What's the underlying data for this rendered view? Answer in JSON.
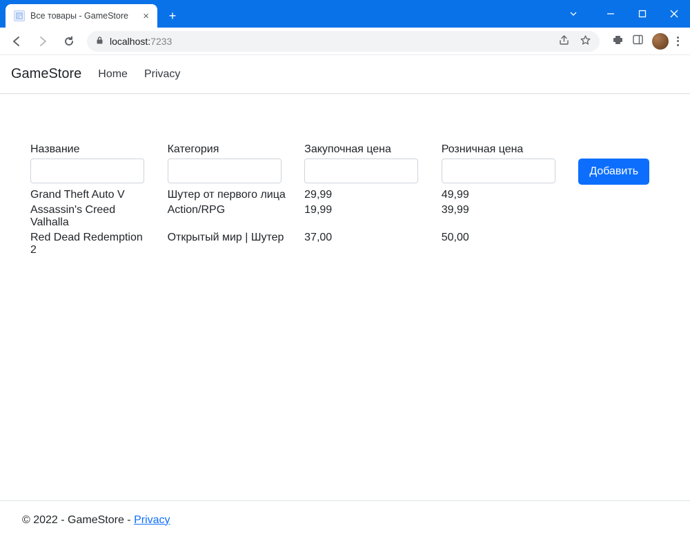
{
  "browser": {
    "tab_title": "Все товары - GameStore",
    "url_host": "localhost:",
    "url_port": "7233"
  },
  "navbar": {
    "brand": "GameStore",
    "links": [
      "Home",
      "Privacy"
    ]
  },
  "table": {
    "headers": {
      "name": "Название",
      "category": "Категория",
      "wholesale": "Закупочная цена",
      "retail": "Розничная цена"
    },
    "add_button": "Добавить",
    "rows": [
      {
        "name": "Grand Theft Auto V",
        "category": "Шутер от первого лица",
        "wholesale": "29,99",
        "retail": "49,99"
      },
      {
        "name": "Assassin's Creed Valhalla",
        "category": "Action/RPG",
        "wholesale": "19,99",
        "retail": "39,99"
      },
      {
        "name": "Red Dead Redemption 2",
        "category": "Открытый мир | Шутер",
        "wholesale": "37,00",
        "retail": "50,00"
      }
    ]
  },
  "footer": {
    "text_prefix": "© 2022 - GameStore - ",
    "privacy_link": "Privacy"
  }
}
